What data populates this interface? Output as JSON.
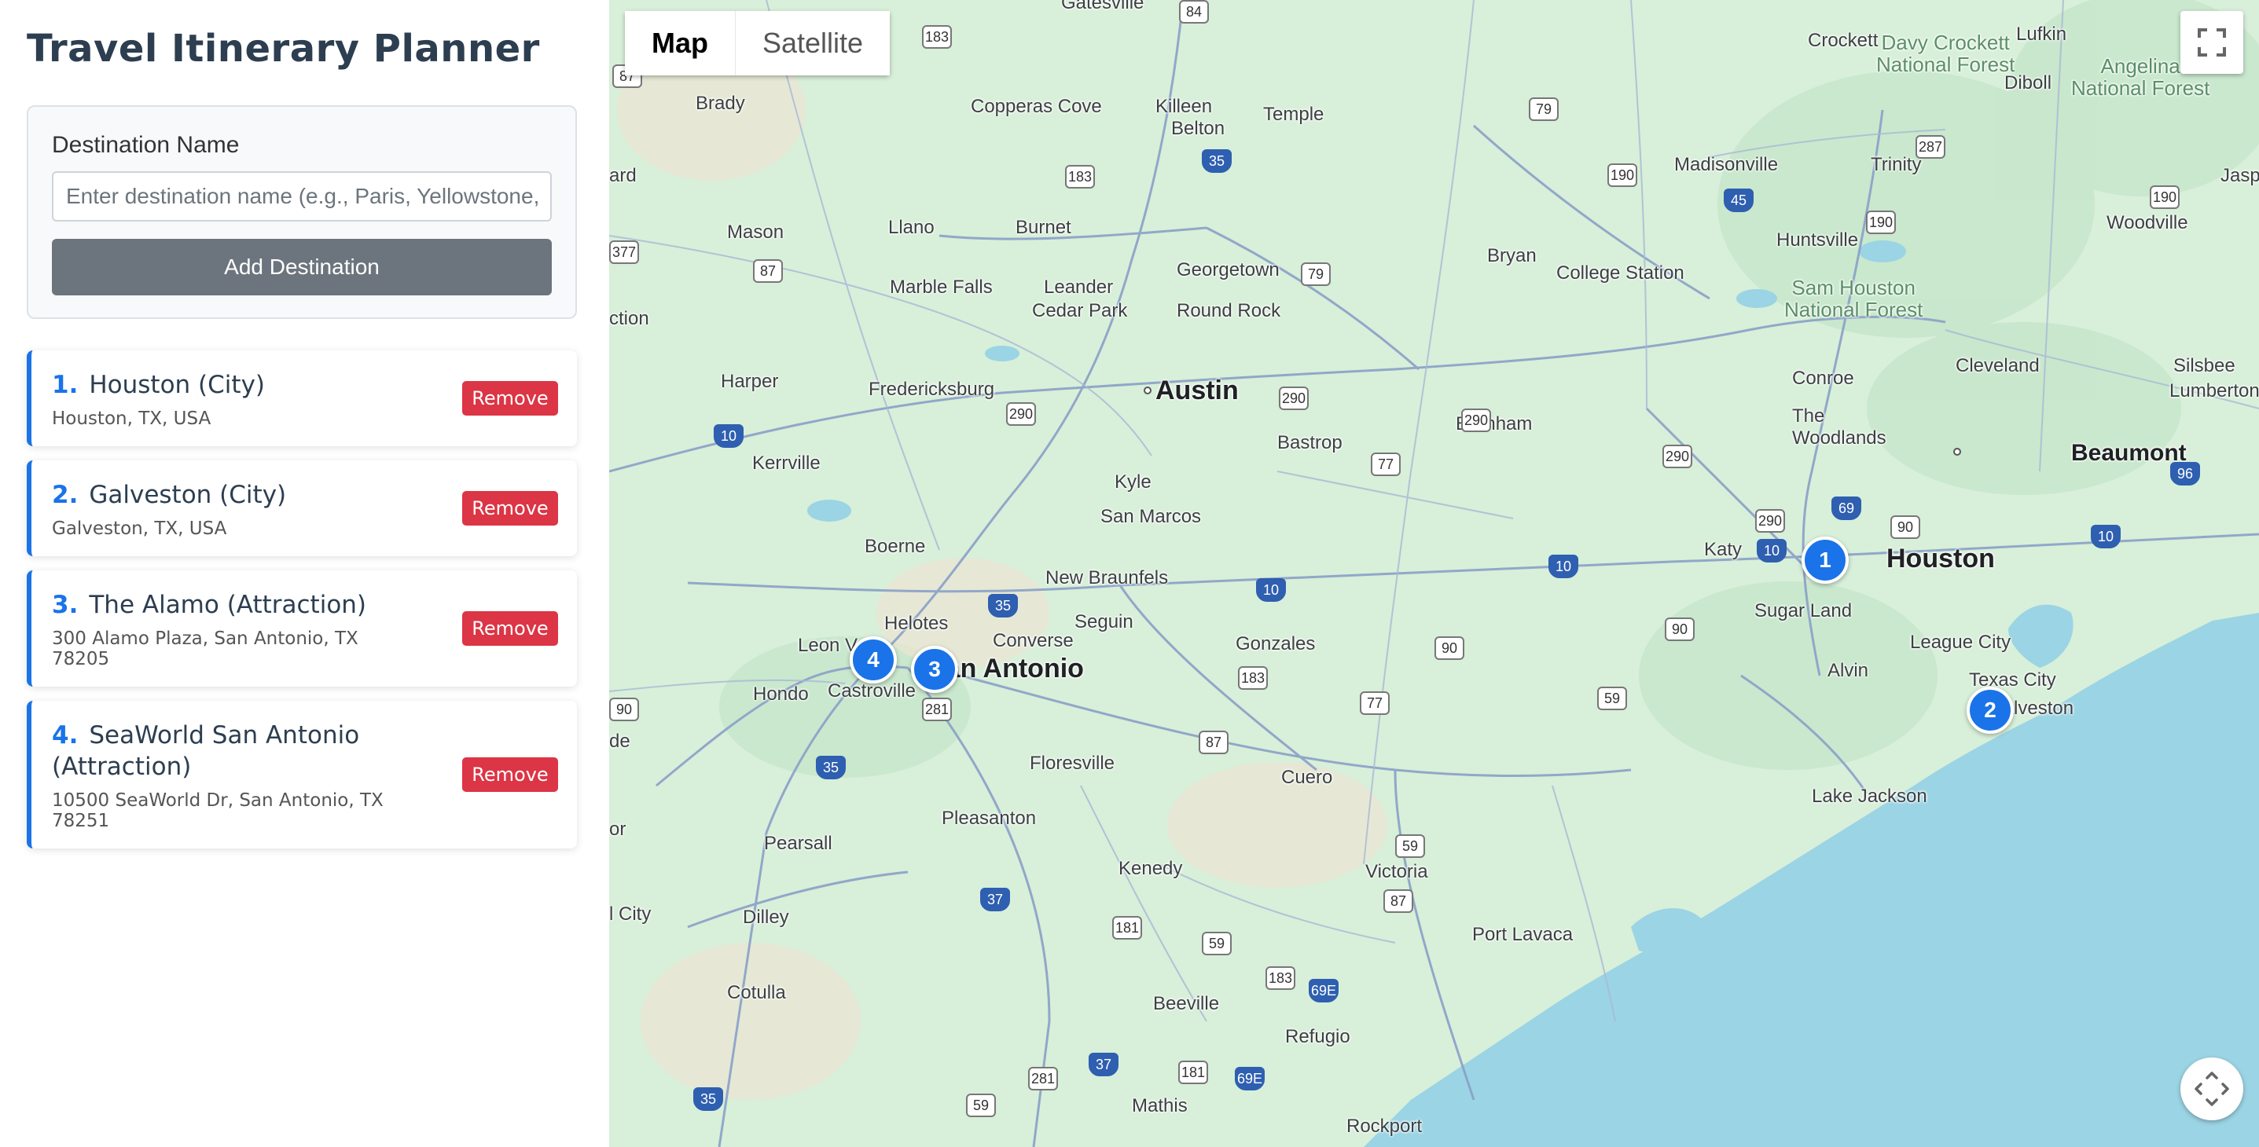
{
  "app": {
    "title": "Travel Itinerary Planner"
  },
  "form": {
    "label": "Destination Name",
    "placeholder": "Enter destination name (e.g., Paris, Yellowstone, Eiffel Tower)",
    "value": "",
    "add_button": "Add Destination"
  },
  "destinations": [
    {
      "number": "1.",
      "name": "Houston (City)",
      "address": "Houston, TX, USA",
      "remove_label": "Remove"
    },
    {
      "number": "2.",
      "name": "Galveston (City)",
      "address": "Galveston, TX, USA",
      "remove_label": "Remove"
    },
    {
      "number": "3.",
      "name": "The Alamo (Attraction)",
      "address": "300 Alamo Plaza, San Antonio, TX 78205",
      "remove_label": "Remove"
    },
    {
      "number": "4.",
      "name": "SeaWorld San Antonio (Attraction)",
      "address": "10500 SeaWorld Dr, San Antonio, TX 78251",
      "remove_label": "Remove"
    }
  ],
  "map": {
    "type_buttons": [
      "Map",
      "Satellite"
    ],
    "selected_type": "Map",
    "markers": [
      "1",
      "2",
      "3",
      "4"
    ],
    "labels": {
      "austin": "Austin",
      "san_antonio": "San Antonio",
      "houston": "Houston",
      "beaumont": "Beaumont",
      "galveston": "Galveston",
      "gatesville": "Gatesville",
      "brady": "Brady",
      "copperas_cove": "Copperas Cove",
      "killeen": "Killeen",
      "belton": "Belton",
      "temple": "Temple",
      "crockett": "Crockett",
      "lufkin": "Lufkin",
      "davy_crockett": "Davy Crockett\nNational Forest",
      "angelina": "Angelina\nNational Forest",
      "diboll": "Diboll",
      "mason": "Mason",
      "llano": "Llano",
      "burnet": "Burnet",
      "madisonville": "Madisonville",
      "trinity": "Trinity",
      "marble_falls": "Marble Falls",
      "leander": "Leander",
      "georgetown": "Georgetown",
      "cedar_park": "Cedar Park",
      "round_rock": "Round Rock",
      "bryan": "Bryan",
      "college_station": "College Station",
      "huntsville": "Huntsville",
      "woodville": "Woodville",
      "sam_houston": "Sam Houston\nNational Forest",
      "harper": "Harper",
      "fredericksburg": "Fredericksburg",
      "conroe": "Conroe",
      "cleveland": "Cleveland",
      "silsbee": "Silsbee",
      "lumberton": "Lumberton",
      "kerrville": "Kerrville",
      "bastrop": "Bastrop",
      "brenham": "Brenham",
      "the_woodlands": "The\nWoodlands",
      "kyle": "Kyle",
      "san_marcos": "San Marcos",
      "boerne": "Boerne",
      "katy": "Katy",
      "new_braunfels": "New Braunfels",
      "sugar_land": "Sugar Land",
      "helotes": "Helotes",
      "converse": "Converse",
      "seguin": "Seguin",
      "gonzales": "Gonzales",
      "league_city": "League City",
      "leon_valley": "Leon V",
      "hondo": "Hondo",
      "castroville": "Castroville",
      "alvin": "Alvin",
      "texas_city": "Texas City",
      "floresville": "Floresville",
      "cuero": "Cuero",
      "lake_jackson": "Lake Jackson",
      "pleasanton": "Pleasanton",
      "pearsall": "Pearsall",
      "kenedy": "Kenedy",
      "victoria": "Victoria",
      "dilley": "Dilley",
      "port_lavaca": "Port Lavaca",
      "cotulla": "Cotulla",
      "beeville": "Beeville",
      "refugio": "Refugio",
      "mathis": "Mathis",
      "rockport": "Rockport",
      "edge_ard": "ard",
      "edge_ction": "ction",
      "edge_de": "de",
      "edge_or": "or",
      "edge_city": "l City",
      "edge_jasp": "Jasp"
    },
    "colors": {
      "water": "#9bd4e4",
      "land": "#d8efd9",
      "marker": "#1a73e8",
      "remove": "#dc3545"
    }
  }
}
